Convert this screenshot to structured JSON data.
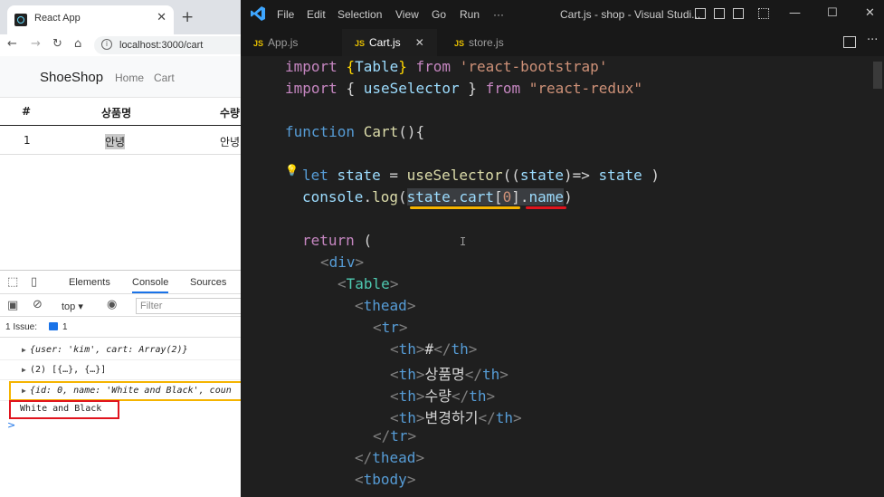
{
  "browser": {
    "tab_title": "React App",
    "url": "localhost:3000/cart",
    "brand": "ShoeShop",
    "nav": [
      "Home",
      "Cart"
    ],
    "table": {
      "headers": [
        "#",
        "상품명",
        "수량"
      ],
      "row": [
        "1",
        "안녕",
        "안녕"
      ]
    }
  },
  "devtools": {
    "tabs": [
      "Elements",
      "Console",
      "Sources"
    ],
    "active_tab": "Console",
    "context": "top",
    "filter_placeholder": "Filter",
    "issues_label": "1 Issue:",
    "issues_count": "1",
    "logs": [
      "{user: 'kim', cart: Array(2)}",
      "(2) [{…}, {…}]",
      "{id: 0, name: 'White and Black', coun"
    ],
    "output": "White and Black",
    "prompt": ">"
  },
  "vscode": {
    "menu": [
      "File",
      "Edit",
      "Selection",
      "View",
      "Go",
      "Run",
      "···"
    ],
    "window_title": "Cart.js - shop - Visual Studi...",
    "tabs": [
      {
        "name": "App.js"
      },
      {
        "name": "Cart.js",
        "active": true
      },
      {
        "name": "store.js"
      }
    ],
    "js_badge": "JS"
  },
  "code": {
    "l1": {
      "a": "import ",
      "b": "{",
      "c": "Table",
      "d": "}",
      "e": " from ",
      "f": "'react-bootstrap'"
    },
    "l2": {
      "a": "import ",
      "b": "{ ",
      "c": "useSelector",
      "d": " }",
      "e": " from ",
      "f": "\"react-redux\""
    },
    "l3": {
      "a": "function ",
      "b": "Cart",
      "c": "(){"
    },
    "l4": {
      "a": "let ",
      "b": "state",
      "c": " = ",
      "d": "useSelector",
      "e": "((",
      "f": "state",
      "g": ")=> ",
      "h": "state",
      "i": " )"
    },
    "l5": {
      "a": "console",
      "b": ".",
      "c": "log",
      "d": "(",
      "e": "state",
      "f": ".",
      "g": "cart",
      "h": "[",
      "i": "0",
      "j": "]",
      "k": ".",
      "l": "name",
      "m": ")"
    },
    "l6": {
      "a": "return ",
      "b": "("
    },
    "l7": {
      "a": "<",
      "b": "div",
      "c": ">"
    },
    "l8": {
      "a": "<",
      "b": "Table",
      "c": ">"
    },
    "l9": {
      "a": "<",
      "b": "thead",
      "c": ">"
    },
    "l10": {
      "a": "<",
      "b": "tr",
      "c": ">"
    },
    "l11": {
      "a": "<",
      "b": "th",
      "c": ">",
      "d": "#",
      "e": "</",
      "f": "th",
      "g": ">"
    },
    "l12": {
      "a": "<",
      "b": "th",
      "c": ">",
      "d": "상품명",
      "e": "</",
      "f": "th",
      "g": ">"
    },
    "l13": {
      "a": "<",
      "b": "th",
      "c": ">",
      "d": "수량",
      "e": "</",
      "f": "th",
      "g": ">"
    },
    "l14": {
      "a": "<",
      "b": "th",
      "c": ">",
      "d": "변경하기",
      "e": "</",
      "f": "th",
      "g": ">"
    },
    "l15": {
      "a": "</",
      "b": "tr",
      "c": ">"
    },
    "l16": {
      "a": "</",
      "b": "thead",
      "c": ">"
    },
    "l17": {
      "a": "<",
      "b": "tbody",
      "c": ">"
    }
  },
  "colors": {
    "highlight_orange": "#f5b400",
    "highlight_red": "#e0141e"
  }
}
